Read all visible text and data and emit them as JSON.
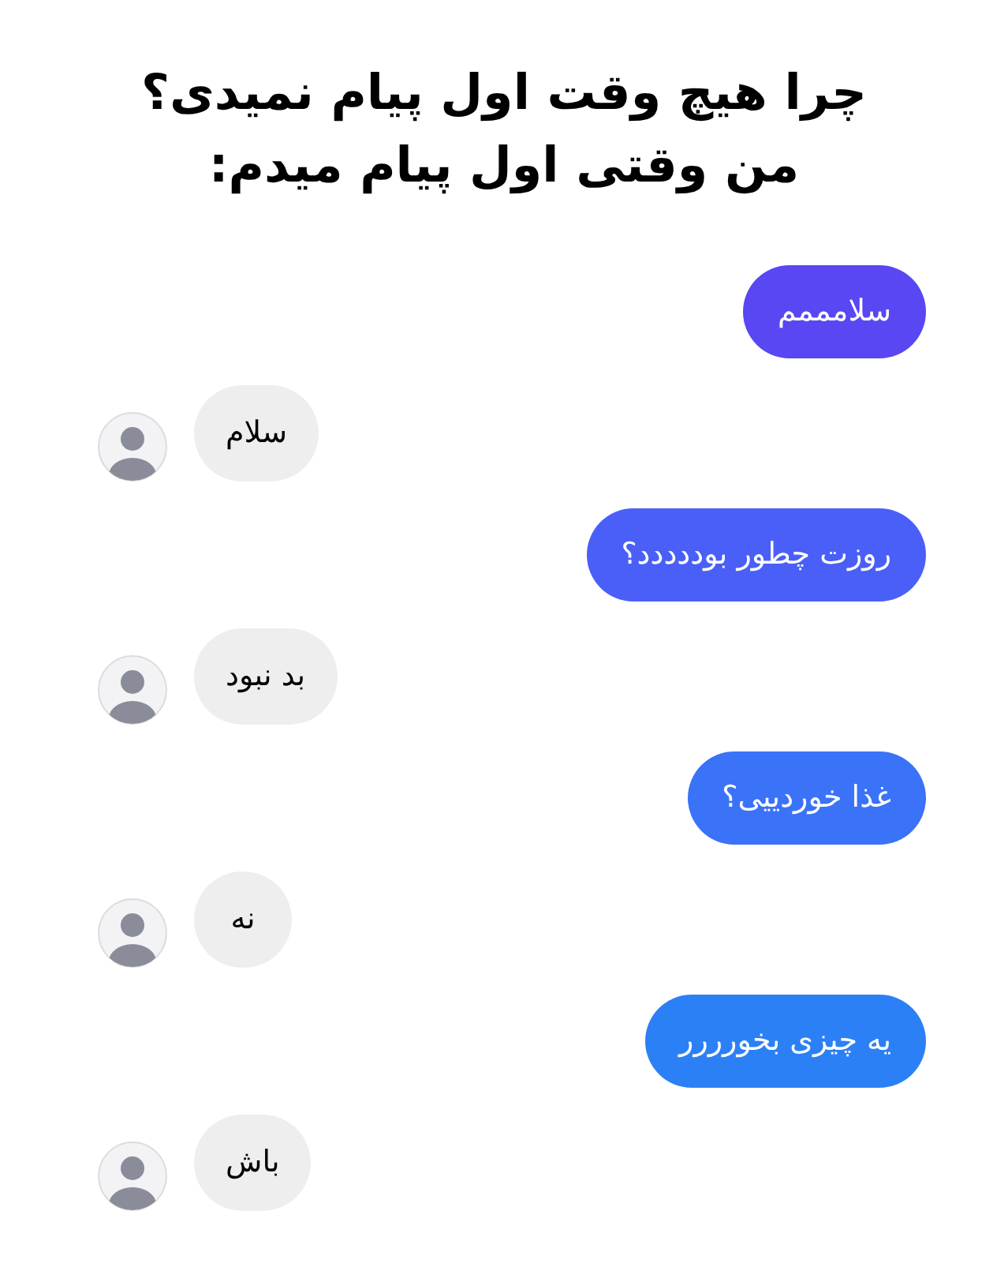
{
  "title_lines": [
    "چرا هیچ وقت اول پیام نمیدی؟",
    "من وقتی اول پیام میدم:"
  ],
  "messages": [
    {
      "kind": "sent",
      "text": "سلامممم",
      "color": "#5847f3"
    },
    {
      "kind": "received",
      "text": "سلام",
      "color": "#eeeeee"
    },
    {
      "kind": "sent",
      "text": "روزت چطور بوددددد؟",
      "color": "#4a5ff7"
    },
    {
      "kind": "received",
      "text": "بد نبود",
      "color": "#eeeeee"
    },
    {
      "kind": "sent",
      "text": "غذا خوردییی؟",
      "color": "#3a72f8"
    },
    {
      "kind": "received",
      "text": "نه",
      "color": "#eeeeee"
    },
    {
      "kind": "sent",
      "text": "یه چیزی بخورررر",
      "color": "#2b80f6"
    },
    {
      "kind": "received",
      "text": "باش",
      "color": "#eeeeee"
    }
  ]
}
